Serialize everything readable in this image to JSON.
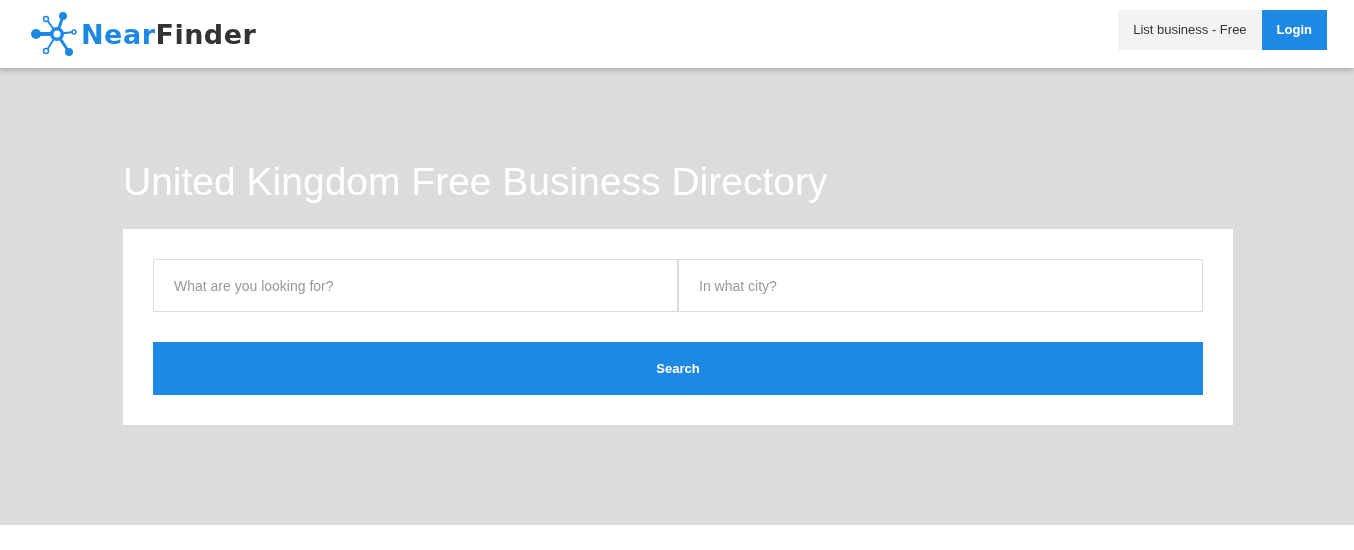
{
  "header": {
    "logo": {
      "part_1": "Near",
      "part_2": "Finder"
    },
    "buttons": [
      {
        "label": "List business - Free",
        "kind": "secondary"
      },
      {
        "label": "Login",
        "kind": "primary"
      }
    ]
  },
  "hero": {
    "title": "United Kingdom Free Business Directory",
    "search": {
      "fields": [
        {
          "placeholder": "What are you looking for?"
        },
        {
          "placeholder": "In what city?"
        }
      ],
      "button": "Search"
    }
  }
}
